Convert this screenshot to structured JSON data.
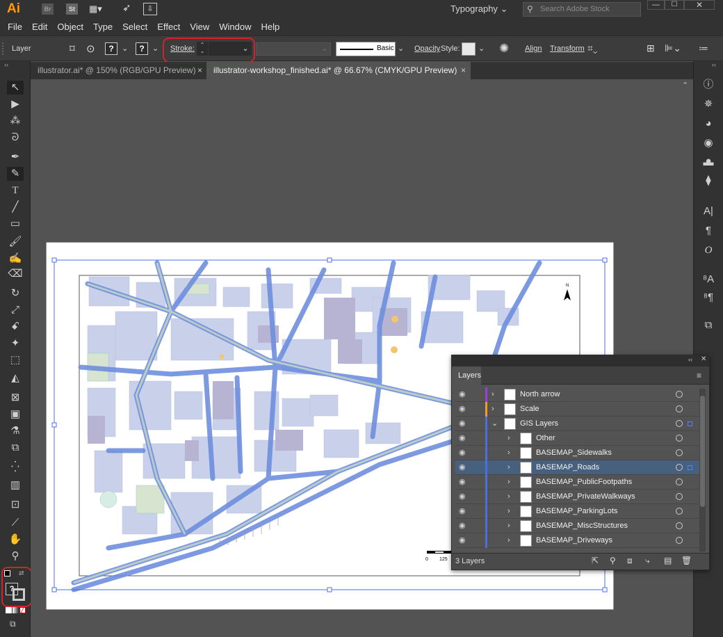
{
  "app": {
    "logo": "Ai",
    "bridge": "Br",
    "stock": "St"
  },
  "workspace": {
    "label": "Typography",
    "search_placeholder": "Search Adobe Stock"
  },
  "menu": [
    "File",
    "Edit",
    "Object",
    "Type",
    "Select",
    "Effect",
    "View",
    "Window",
    "Help"
  ],
  "control": {
    "selection_label": "Layer",
    "fill_question": "?",
    "stroke_question": "?",
    "stroke_label": "Stroke:",
    "brush_label": "Basic",
    "opacity_label": "Opacity",
    "style_label": "Style:",
    "align_label": "Align",
    "transform_label": "Transform"
  },
  "tabs": [
    {
      "label": "illustrator.ai* @ 150% (RGB/GPU Preview)",
      "active": false
    },
    {
      "label": "illustrator-workshop_finished.ai* @ 66.67% (CMYK/GPU Preview)",
      "active": true
    }
  ],
  "tab_close": "×",
  "map": {
    "north_label": "N",
    "scale_0": "0",
    "scale_125": "125"
  },
  "layers_panel": {
    "title": "Layers",
    "footer": "3 Layers",
    "rows": [
      {
        "name": "North arrow",
        "color": "#9b3de0",
        "indent": 0,
        "expanded": false,
        "selected": false
      },
      {
        "name": "Scale",
        "color": "#f0a020",
        "indent": 0,
        "expanded": false,
        "selected": false
      },
      {
        "name": "GIS Layers",
        "color": "#4a6fe0",
        "indent": 0,
        "expanded": true,
        "selected": false
      },
      {
        "name": "Other",
        "color": "#4a6fe0",
        "indent": 1,
        "expanded": false,
        "selected": false
      },
      {
        "name": "BASEMAP_Sidewalks",
        "color": "#4a6fe0",
        "indent": 1,
        "expanded": false,
        "selected": false
      },
      {
        "name": "BASEMAP_Roads",
        "color": "#4a6fe0",
        "indent": 1,
        "expanded": false,
        "selected": true
      },
      {
        "name": "BASEMAP_PublicFootpaths",
        "color": "#4a6fe0",
        "indent": 1,
        "expanded": false,
        "selected": false
      },
      {
        "name": "BASEMAP_PrivateWalkways",
        "color": "#4a6fe0",
        "indent": 1,
        "expanded": false,
        "selected": false
      },
      {
        "name": "BASEMAP_ParkingLots",
        "color": "#4a6fe0",
        "indent": 1,
        "expanded": false,
        "selected": false
      },
      {
        "name": "BASEMAP_MiscStructures",
        "color": "#4a6fe0",
        "indent": 1,
        "expanded": false,
        "selected": false
      },
      {
        "name": "BASEMAP_Driveways",
        "color": "#4a6fe0",
        "indent": 1,
        "expanded": false,
        "selected": false
      }
    ]
  },
  "toolbar_bottom": {
    "fill_question": "?"
  },
  "colors": {
    "accent": "#46607e",
    "highlight_ring": "#d8202a",
    "selection": "#4a6fe0"
  }
}
